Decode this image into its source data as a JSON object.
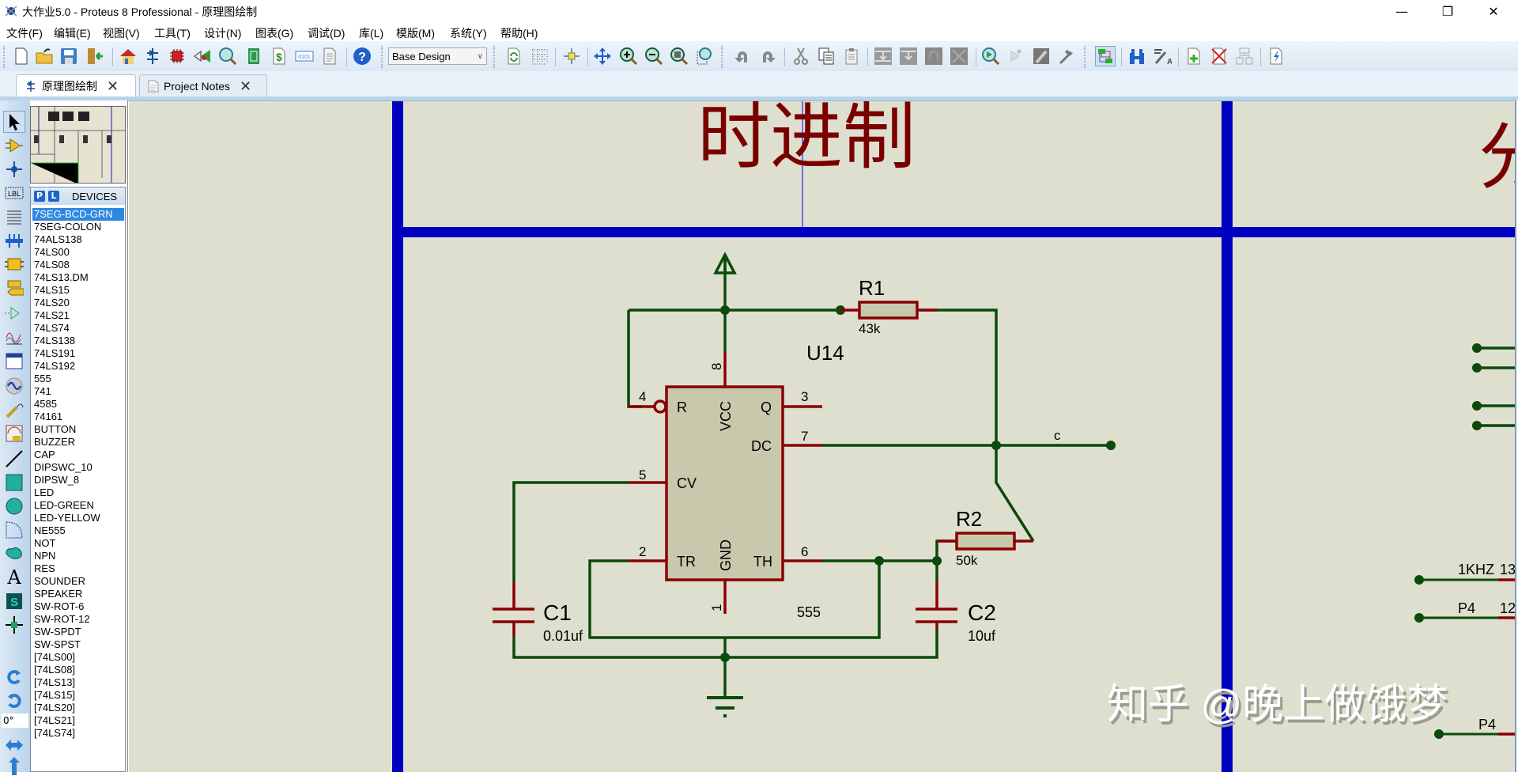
{
  "window": {
    "title": "大作业5.0 - Proteus 8 Professional - 原理图绘制",
    "minimize": "—",
    "restore": "❐",
    "close": "✕"
  },
  "menu": [
    "文件(F)",
    "编辑(E)",
    "视图(V)",
    "工具(T)",
    "设计(N)",
    "图表(G)",
    "调试(D)",
    "库(L)",
    "模版(M)",
    "系统(Y)",
    "帮助(H)"
  ],
  "toolbar": {
    "design_select": "Base Design",
    "icons": [
      "new-file-icon",
      "open-folder-icon",
      "save-icon",
      "import-icon",
      "home-icon",
      "schematic-icon",
      "pcb-icon",
      "3d-viewer-icon",
      "gerber-viewer-icon",
      "design-explorer-icon",
      "bill-of-materials-icon",
      "source-code-icon",
      "project-notes-icon",
      "help-icon",
      "refresh-icon",
      "grid-icon",
      "origin-icon",
      "pan-icon",
      "zoom-in-icon",
      "zoom-out-icon",
      "zoom-all-icon",
      "zoom-area-icon",
      "undo-icon",
      "redo-icon",
      "cut-icon",
      "copy-icon",
      "paste-icon",
      "block-copy-icon",
      "block-move-icon",
      "block-rotate-icon",
      "block-delete-icon",
      "pick-device-icon",
      "make-device-icon",
      "packaging-tool-icon",
      "decompose-icon",
      "wire-autorouter-icon",
      "search-icon",
      "property-assignment-icon",
      "new-sheet-icon",
      "remove-sheet-icon",
      "goto-sheet-icon",
      "electrical-rule-check-icon"
    ]
  },
  "tabs": [
    {
      "label": "原理图绘制",
      "active": true,
      "close": "✕"
    },
    {
      "label": "Project Notes",
      "active": false,
      "close": "✕"
    }
  ],
  "left_tools": [
    "selection-mode-icon",
    "component-mode-icon",
    "junction-dot-icon",
    "wire-label-icon",
    "text-script-icon",
    "bus-icon",
    "subcircuit-icon",
    "terminal-icon",
    "device-pin-icon",
    "graph-icon",
    "tape-recorder-icon",
    "generator-icon",
    "voltage-probe-icon",
    "virtual-instrument-icon",
    "line-icon",
    "box-icon",
    "circle-icon",
    "arc-icon",
    "path-icon",
    "text-icon",
    "symbol-icon",
    "marker-icon",
    "rotate-cw-icon",
    "rotate-ccw-icon",
    "mirror-x-icon",
    "mirror-y-icon"
  ],
  "rotation_value": "0°",
  "devices": {
    "p_label": "P",
    "l_label": "L",
    "title": "DEVICES",
    "selected": "7SEG-BCD-GRN",
    "items": [
      "7SEG-BCD-GRN",
      "7SEG-COLON",
      "74ALS138",
      "74LS00",
      "74LS08",
      "74LS13.DM",
      "74LS15",
      "74LS20",
      "74LS21",
      "74LS74",
      "74LS138",
      "74LS191",
      "74LS192",
      "555",
      "741",
      "4585",
      "74161",
      "BUTTON",
      "BUZZER",
      "CAP",
      "DIPSWC_10",
      "DIPSW_8",
      "LED",
      "LED-GREEN",
      "LED-YELLOW",
      "NE555",
      "NOT",
      "NPN",
      "RES",
      "SOUNDER",
      "SPEAKER",
      "SW-ROT-6",
      "SW-ROT-12",
      "SW-SPDT",
      "SW-SPST",
      "[74LS00]",
      "[74LS08]",
      "[74LS13]",
      "[74LS15]",
      "[74LS20]",
      "[74LS21]",
      "[74LS74]"
    ]
  },
  "schematic": {
    "section_title": "时进制",
    "section_title_right": "分",
    "colors": {
      "wire": "#0a4a0a",
      "pin": "#8b0000",
      "frame": "#0000c0",
      "body": "#c8c8ac",
      "bg": "#dfdfd0"
    },
    "u14": {
      "ref": "U14",
      "value": "555",
      "pins": {
        "R": "R",
        "VCC": "VCC",
        "Q": "Q",
        "DC": "DC",
        "CV": "CV",
        "TR": "TR",
        "GND": "GND",
        "TH": "TH"
      },
      "pin_numbers": {
        "p4": "4",
        "p8": "8",
        "p3": "3",
        "p7": "7",
        "p5": "5",
        "p2": "2",
        "p6": "6",
        "p1": "1"
      }
    },
    "r1": {
      "ref": "R1",
      "value": "43k"
    },
    "r2": {
      "ref": "R2",
      "value": "50k"
    },
    "c1": {
      "ref": "C1",
      "value": "0.01uf"
    },
    "c2": {
      "ref": "C2",
      "value": "10uf"
    },
    "net_label_c": "c",
    "right_labels": {
      "l1": "1KHZ",
      "n1": "13",
      "l2": "P4",
      "n2": "12",
      "l3": "P4"
    }
  },
  "watermark": "知乎 @晚上做饿梦"
}
